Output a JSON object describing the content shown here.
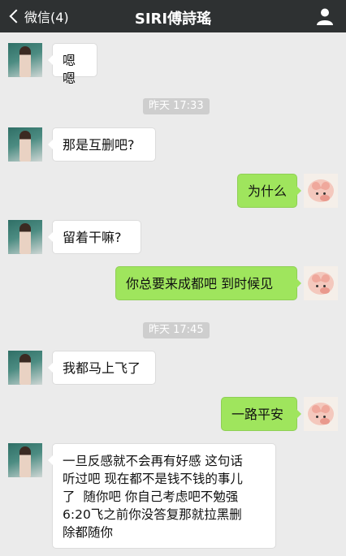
{
  "header": {
    "back_label": "微信(4)",
    "title": "SIRI傅詩瑤",
    "back_icon": "chevron-left-icon",
    "profile_icon": "person-icon"
  },
  "timestamps": [
    "昨天 17:33",
    "昨天 17:45"
  ],
  "messages": [
    {
      "side": "left",
      "text": "嗯嗯"
    },
    {
      "side": "left",
      "text": "那是互删吧?"
    },
    {
      "side": "right",
      "text": "为什么"
    },
    {
      "side": "left",
      "text": "留着干嘛?"
    },
    {
      "side": "right",
      "text": "你总要来成都吧 到时候见"
    },
    {
      "side": "left",
      "text": "我都马上飞了"
    },
    {
      "side": "right",
      "text": "一路平安"
    },
    {
      "side": "left",
      "text": "一旦反感就不会再有好感 这句话\n听过吧 现在都不是钱不钱的事儿\n了  随你吧 你自己考虑吧不勉强\n6:20飞之前你没答复那就拉黑删\n除都随你"
    }
  ],
  "colors": {
    "header_bg": "#2e3132",
    "chat_bg": "#ebebeb",
    "bubble_self": "#9fe55d",
    "bubble_other": "#ffffff",
    "timestamp_bg": "#cecece"
  }
}
